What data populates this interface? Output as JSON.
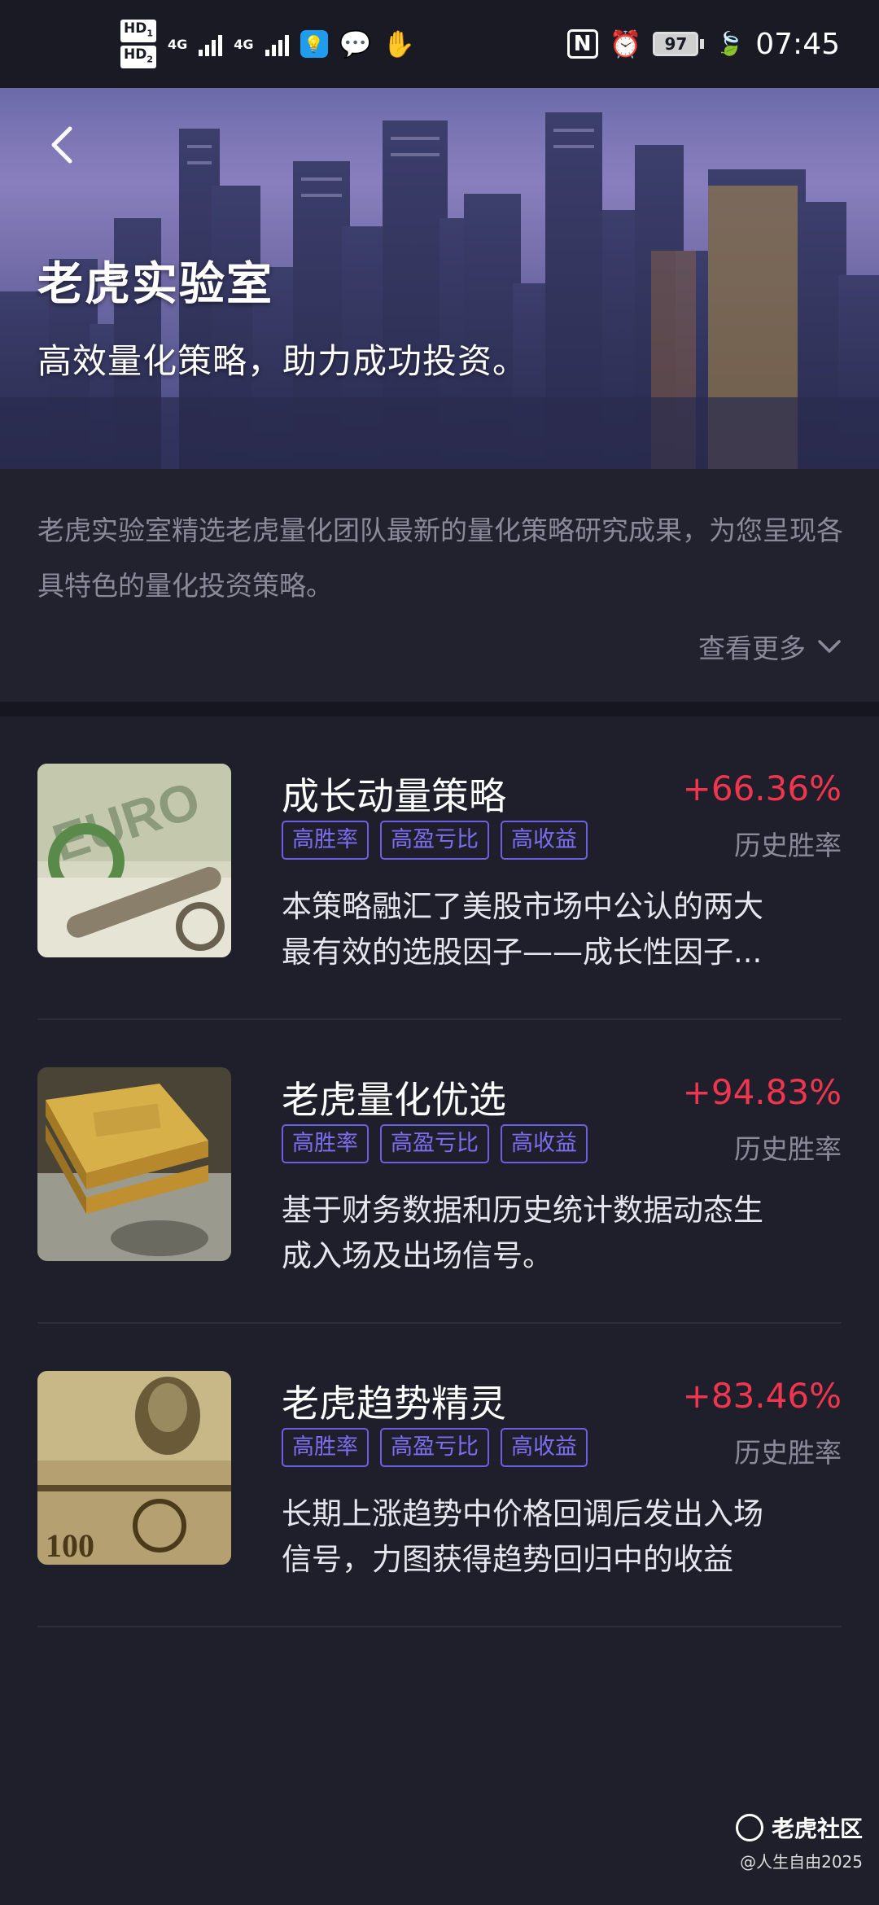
{
  "status_bar": {
    "hd1": "HD",
    "hd1_sub": "1",
    "hd2": "HD",
    "hd2_sub": "2",
    "net1": "4G",
    "net2": "4G",
    "battery": "97",
    "time": "07:45"
  },
  "hero": {
    "title": "老虎实验室",
    "subtitle": "高效量化策略，助力成功投资。"
  },
  "intro": {
    "text": "老虎实验室精选老虎量化团队最新的量化策略研究成果，为您呈现各具特色的量化投资策略。",
    "see_more": "查看更多"
  },
  "strategies": [
    {
      "name": "成长动量策略",
      "return": "+66.36%",
      "return_label": "历史胜率",
      "tags": [
        "高胜率",
        "高盈亏比",
        "高收益"
      ],
      "desc_line1": "本策略融汇了美股市场中公认的两大",
      "desc_line2": "最有效的选股因子——成长性因子...",
      "thumb": "euro-banknote-key"
    },
    {
      "name": "老虎量化优选",
      "return": "+94.83%",
      "return_label": "历史胜率",
      "tags": [
        "高胜率",
        "高盈亏比",
        "高收益"
      ],
      "desc_line1": "基于财务数据和历史统计数据动态生",
      "desc_line2": "成入场及出场信号。",
      "thumb": "gold-bars-dollars"
    },
    {
      "name": "老虎趋势精灵",
      "return": "+83.46%",
      "return_label": "历史胜率",
      "tags": [
        "高胜率",
        "高盈亏比",
        "高收益"
      ],
      "desc_line1": "长期上涨趋势中价格回调后发出入场",
      "desc_line2": "信号，力图获得趋势回归中的收益",
      "thumb": "hundred-dollar-bills"
    }
  ],
  "watermark": {
    "brand": "老虎社区",
    "user": "@人生自由2025"
  },
  "colors": {
    "background": "#1f1f2b",
    "accent_red": "#f0364f",
    "tag_purple": "#7c6ef0",
    "muted_text": "#8a8a99"
  }
}
